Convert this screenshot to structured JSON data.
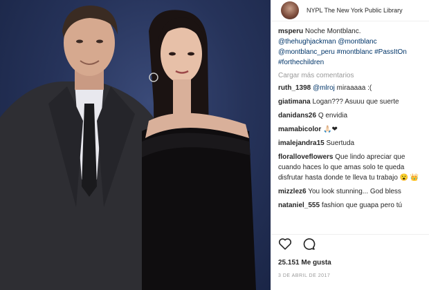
{
  "header": {
    "location": "NYPL The New York Public Library"
  },
  "caption": {
    "user": "msperu",
    "text": "Noche Montblanc.",
    "tags_line1": "@thehughjackman @montblanc",
    "tags_line2": "@montblanc_peru #montblanc #PassItOn",
    "tags_line3": "#forthechildren"
  },
  "load_more": "Cargar más comentarios",
  "comments": [
    {
      "user": "ruth_1398",
      "mention": "@mlroj",
      "text": "miraaaaa :("
    },
    {
      "user": "giatimana",
      "text": "Logan??? Asuuu que suerte"
    },
    {
      "user": "danidans26",
      "text": "Q envidia"
    },
    {
      "user": "mamabicolor",
      "text": "🙏🏻❤"
    },
    {
      "user": "imalejandra15",
      "text": "Suertuda"
    },
    {
      "user": "floralloveflowers",
      "text": "Que lindo apreciar que cuando haces lo que amas solo te queda disfrutar hasta donde te lleva tu trabajo 😮 👑"
    },
    {
      "user": "mizzlez6",
      "text": "You look stunning... God bless"
    },
    {
      "user": "nataniel_555",
      "text": "fashion que guapa pero tú"
    }
  ],
  "likes": "25.151 Me gusta",
  "date": "3 DE ABRIL DE 2017",
  "icons": [
    "heart-icon",
    "comment-icon"
  ]
}
